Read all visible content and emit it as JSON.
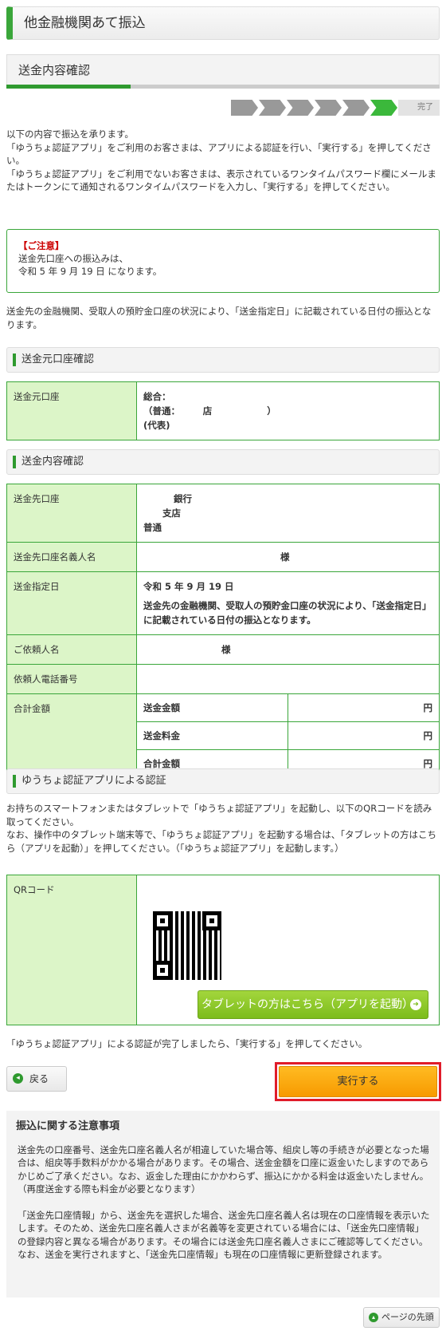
{
  "page_title": "他金融機関あて振込",
  "sub_title": "送金内容確認",
  "progress": {
    "steps_total": 6,
    "active_step": 6,
    "end_label": "完了"
  },
  "intro": [
    "以下の内容で振込を承ります。",
    "「ゆうちょ認証アプリ」をご利用のお客さまは、アプリによる認証を行い、「実行する」を押してください。",
    "「ゆうちょ認証アプリ」をご利用でないお客さまは、表示されているワンタイムパスワード欄にメールまたはトークンにて通知されるワンタイムパスワードを入力し、「実行する」を押してください。"
  ],
  "notice": {
    "title": "【ご注意】",
    "line1": "送金先口座への振込みは、",
    "line2": "令和 5 年 9 月 19 日 になります。"
  },
  "date_note": "送金先の金融機関、受取人の預貯金口座の状況により、「送金指定日」に記載されている日付の振込となります。",
  "source_section": {
    "heading": "送金元口座確認",
    "label": "送金元口座",
    "line1": "総合：",
    "line2": "（普通：　　　店　　　　　　）",
    "line3": "(代表)"
  },
  "details_section": {
    "heading": "送金内容確認",
    "dest_label": "送金先口座",
    "dest_bank": "銀行",
    "dest_branch": "支店",
    "dest_type": "普通",
    "name_label": "送金先口座名義人名",
    "name_value": "様",
    "date_label": "送金指定日",
    "date_value": "令和 5 年 9 月 19 日",
    "date_note": "送金先の金融機関、受取人の預貯金口座の状況により、「送金指定日」に記載されている日付の振込となります。",
    "requester_label": "ご依頼人名",
    "requester_value": "様",
    "phone_label": "依頼人電話番号",
    "phone_value": "",
    "total_label": "合計金額",
    "amounts": [
      {
        "label": "送金金額",
        "value": "円"
      },
      {
        "label": "送金料金",
        "value": "円"
      },
      {
        "label": "合計金額",
        "value": "円"
      }
    ]
  },
  "auth_section": {
    "heading": "ゆうちょ認証アプリによる認証",
    "text1": "お持ちのスマートフォンまたはタブレットで「ゆうちょ認証アプリ」を起動し、以下のQRコードを読み取ってください。",
    "text2": "なお、操作中のタブレット端末等で、「ゆうちょ認証アプリ」を起動する場合は、「タブレットの方はこちら（アプリを起動）」を押してください。（「ゆうちょ認証アプリ」を起動します。）",
    "qr_label": "QRコード",
    "tablet_button": "タブレットの方はこちら（アプリを起動）",
    "after_text": "「ゆうちょ認証アプリ」による認証が完了しましたら、「実行する」を押してください。"
  },
  "actions": {
    "back": "戻る",
    "execute": "実行する"
  },
  "caution": {
    "title": "振込に関する注意事項",
    "p1": "送金先の口座番号、送金先口座名義人名が相違していた場合等、組戻し等の手続きが必要となった場合は、組戻等手数料がかかる場合があります。その場合、送金金額を口座に返金いたしますのであらかじめご了承ください。なお、返金した理由にかかわらず、振込にかかる料金は返金いたしません。（再度送金する際も料金が必要となります）",
    "p2": "「送金先口座情報」から、送金先を選択した場合、送金先口座名義人名は現在の口座情報を表示いたします。そのため、送金先口座名義人さまが名義等を変更されている場合には、「送金先口座情報」の登録内容と異なる場合があります。その場合には送金先口座名義人さまにご確認等してください。 なお、送金を実行されますと、「送金先口座情報」も現在の口座情報に更新登録されます。"
  },
  "page_top": "ページの先頭",
  "colors": {
    "accent": "#3aa63a",
    "label_bg": "#dcf5c8",
    "execute": "#f79a00",
    "highlight": "#e01c2a"
  }
}
